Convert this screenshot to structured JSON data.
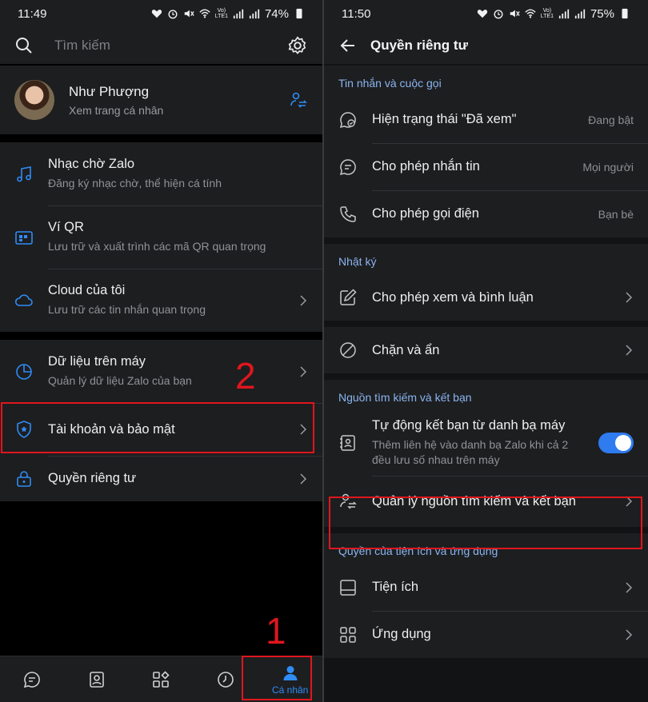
{
  "left": {
    "status": {
      "time": "11:49",
      "battery": "74%"
    },
    "search": {
      "placeholder": "Tìm kiếm"
    },
    "profile": {
      "name": "Như Phượng",
      "subtitle": "Xem trang cá nhân"
    },
    "group1": [
      {
        "title": "Nhạc chờ Zalo",
        "subtitle": "Đăng ký nhạc chờ, thể hiện cá tính"
      },
      {
        "title": "Ví QR",
        "subtitle": "Lưu trữ và xuất trình các mã QR quan trọng"
      },
      {
        "title": "Cloud của tôi",
        "subtitle": "Lưu trữ các tin nhắn quan trọng"
      }
    ],
    "group2": [
      {
        "title": "Dữ liệu trên máy",
        "subtitle": "Quản lý dữ liệu Zalo của bạn"
      },
      {
        "title": "Tài khoản và bảo mật"
      },
      {
        "title": "Quyền riêng tư"
      }
    ],
    "nav": {
      "active_label": "Cá nhân"
    },
    "annotations": {
      "step1": "1",
      "step2": "2"
    }
  },
  "right": {
    "status": {
      "time": "11:50",
      "battery": "75%"
    },
    "header": {
      "title": "Quyền riêng tư"
    },
    "sections": {
      "messages": {
        "title": "Tin nhắn và cuộc gọi",
        "rows": [
          {
            "title": "Hiện trạng thái \"Đã xem\"",
            "value": "Đang bật"
          },
          {
            "title": "Cho phép nhắn tin",
            "value": "Mọi người"
          },
          {
            "title": "Cho phép gọi điện",
            "value": "Bạn bè"
          }
        ]
      },
      "diary": {
        "title": "Nhật ký",
        "rows": [
          {
            "title": "Cho phép xem và bình luận"
          }
        ]
      },
      "block": {
        "rows": [
          {
            "title": "Chặn và ẩn"
          }
        ]
      },
      "sources": {
        "title": "Nguồn tìm kiếm và kết bạn",
        "rows": [
          {
            "title": "Tự động kết bạn từ danh bạ máy",
            "subtitle": "Thêm liên hệ vào danh bạ Zalo khi cả 2 đều lưu số nhau trên máy",
            "toggle_on": true
          },
          {
            "title": "Quản lý nguồn tìm kiếm và kết bạn"
          }
        ]
      },
      "apps": {
        "title": "Quyền của tiện ích và ứng dụng",
        "rows": [
          {
            "title": "Tiện ích"
          },
          {
            "title": "Ứng dụng"
          }
        ]
      }
    }
  },
  "colors": {
    "accent": "#2f8cf5",
    "annotation": "#e0161d",
    "section_title": "#8ab4f0"
  }
}
